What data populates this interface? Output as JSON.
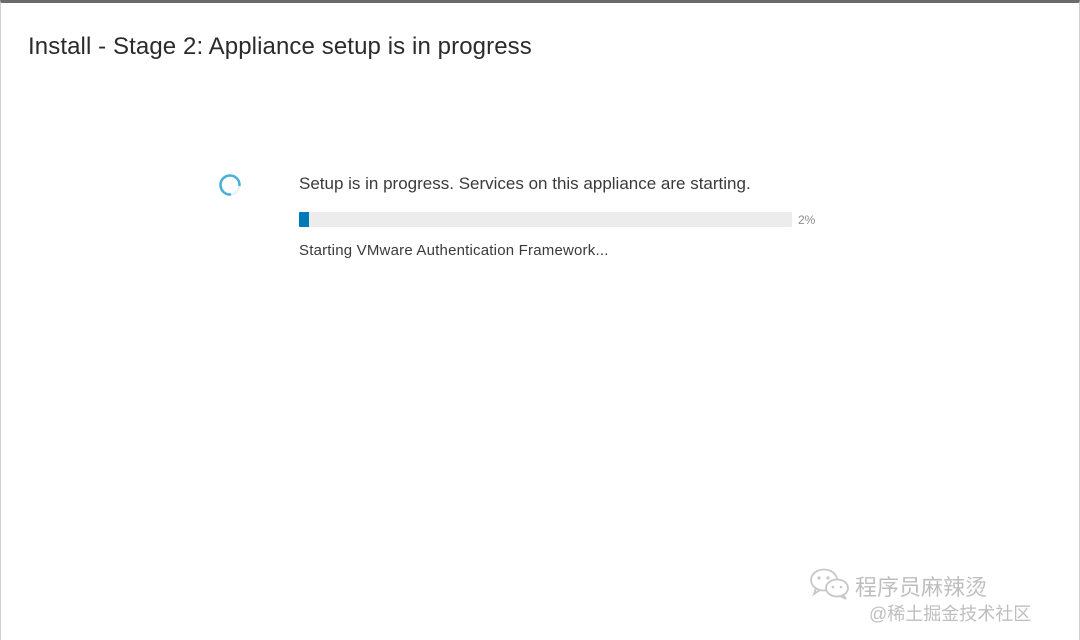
{
  "dialog": {
    "title": "Install - Stage 2: Appliance setup is in progress"
  },
  "progress": {
    "status_text": "Setup is in progress. Services on this appliance are starting.",
    "percent_label": "2%",
    "percent_value": 0.02,
    "detail_text": "Starting VMware Authentication Framework..."
  },
  "watermark": {
    "line1": "程序员麻辣烫",
    "line2": "@稀土掘金技术社区"
  },
  "colors": {
    "progress_fill": "#0079b8",
    "spinner": "#49afd9"
  },
  "icons": {
    "spinner": "loading-spinner-icon",
    "wechat": "wechat-icon"
  }
}
